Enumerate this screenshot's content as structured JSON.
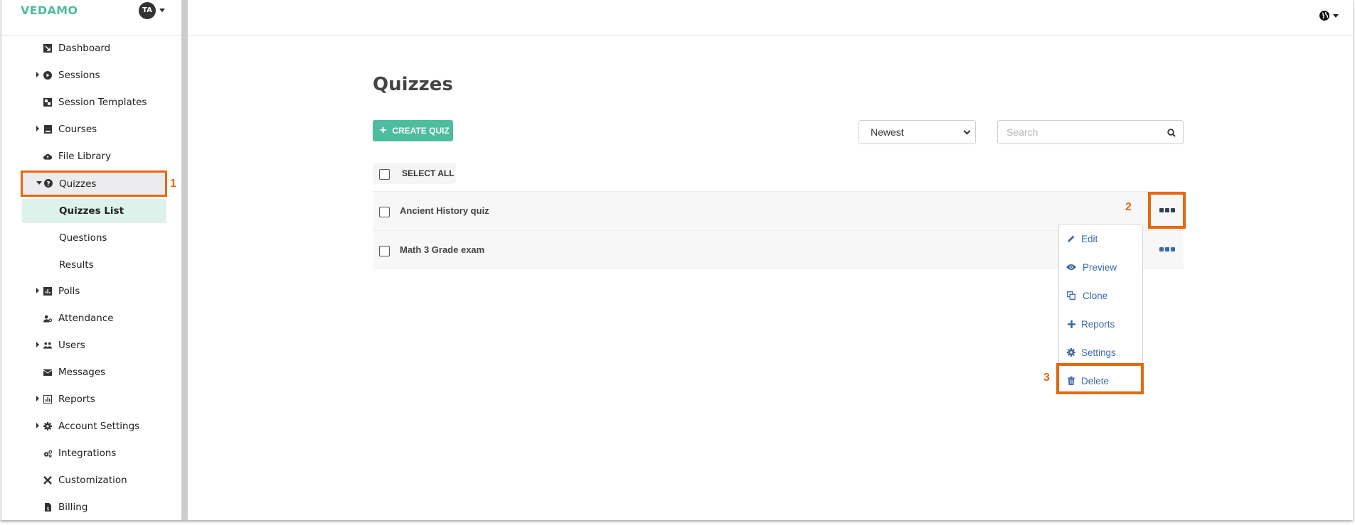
{
  "brand": {
    "logo": "VEDAMO",
    "avatar_initials": "TA",
    "accent": "#4dbc9f",
    "annotation_color": "#e8670f",
    "link_color": "#3c6aa8"
  },
  "sidebar": {
    "items": [
      {
        "label": "Dashboard",
        "icon": "dashboard-icon",
        "expandable": false
      },
      {
        "label": "Sessions",
        "icon": "play-circle-icon",
        "expandable": true
      },
      {
        "label": "Session Templates",
        "icon": "template-icon",
        "expandable": false
      },
      {
        "label": "Courses",
        "icon": "book-icon",
        "expandable": true
      },
      {
        "label": "File Library",
        "icon": "cloud-upload-icon",
        "expandable": false
      },
      {
        "label": "Quizzes",
        "icon": "question-circle-icon",
        "expandable": true,
        "expanded": true
      },
      {
        "label": "Quizzes List",
        "sub": true,
        "active": true
      },
      {
        "label": "Questions",
        "sub": true
      },
      {
        "label": "Results",
        "sub": true
      },
      {
        "label": "Polls",
        "icon": "bar-chart-icon",
        "expandable": true
      },
      {
        "label": "Attendance",
        "icon": "user-check-icon",
        "expandable": false
      },
      {
        "label": "Users",
        "icon": "users-icon",
        "expandable": true
      },
      {
        "label": "Messages",
        "icon": "envelope-icon",
        "expandable": false
      },
      {
        "label": "Reports",
        "icon": "report-chart-icon",
        "expandable": true
      },
      {
        "label": "Account Settings",
        "icon": "gear-icon",
        "expandable": true
      },
      {
        "label": "Integrations",
        "icon": "cogs-icon",
        "expandable": false
      },
      {
        "label": "Customization",
        "icon": "tools-icon",
        "expandable": false
      },
      {
        "label": "Billing",
        "icon": "invoice-icon",
        "expandable": false
      }
    ]
  },
  "topbar": {
    "language_icon": "globe-icon"
  },
  "main": {
    "title": "Quizzes",
    "create_button": "CREATE QUIZ",
    "sort": {
      "selected": "Newest"
    },
    "search": {
      "placeholder": "Search",
      "value": ""
    },
    "select_all": "SELECT ALL",
    "rows": [
      {
        "title": "Ancient History quiz"
      },
      {
        "title": "Math 3 Grade exam"
      }
    ]
  },
  "row_menu": {
    "items": [
      {
        "label": "Edit",
        "icon": "pencil-icon"
      },
      {
        "label": "Preview",
        "icon": "eye-icon"
      },
      {
        "label": "Clone",
        "icon": "clone-icon"
      },
      {
        "label": "Reports",
        "icon": "plus-icon"
      },
      {
        "label": "Settings",
        "icon": "gear-icon"
      },
      {
        "label": "Delete",
        "icon": "trash-icon"
      }
    ]
  },
  "annotations": {
    "step1": "1",
    "step2": "2",
    "step3": "3"
  }
}
